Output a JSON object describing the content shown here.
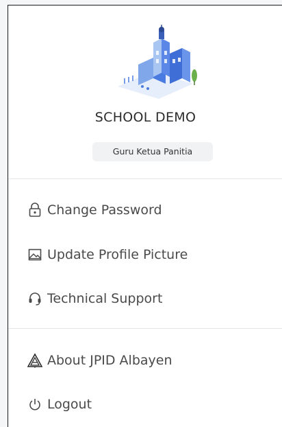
{
  "profile": {
    "school_name": "SCHOOL DEMO",
    "role": "Guru Ketua Panitia"
  },
  "menu": {
    "change_password": "Change Password",
    "update_profile_picture": "Update Profile Picture",
    "technical_support": "Technical Support",
    "about": "About JPID Albayen",
    "logout": "Logout"
  },
  "colors": {
    "logo_blue": "#4a7be0",
    "logo_light_blue": "#a9c6f2",
    "logo_green": "#6ab04c",
    "badge_bg": "#f1f2f4",
    "divider": "#e4e6e9"
  },
  "icons": {
    "change_password": "lock-icon",
    "update_profile_picture": "image-icon",
    "technical_support": "headset-icon",
    "about": "albayen-logo-icon",
    "logout": "power-icon"
  }
}
